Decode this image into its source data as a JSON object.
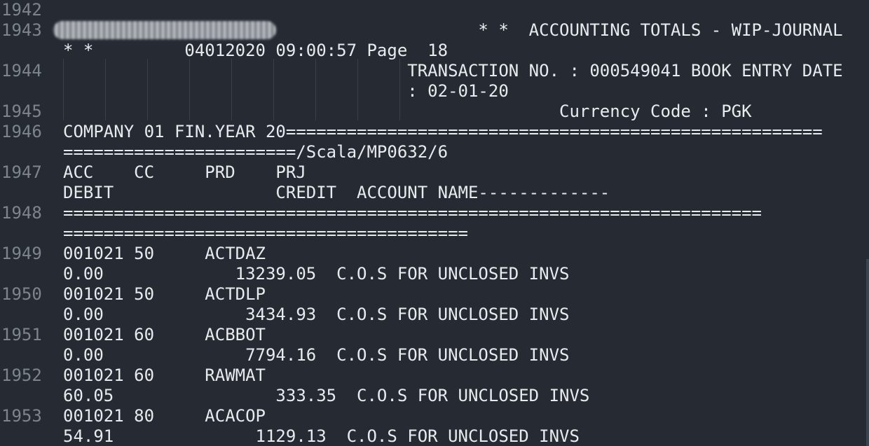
{
  "gutter": [
    "1942",
    "1943",
    "1944",
    "1945",
    "1946",
    "1947",
    "1948",
    "1949",
    "1950",
    "1951",
    "1952",
    "1953"
  ],
  "lines": [
    "",
    "                                         * *  ACCOUNTING TOTALS - WIP-JOURNAL",
    "* *         04012020 09:00:57 Page  18",
    "                                  TRANSACTION NO. : 000549041 BOOK ENTRY DATE",
    "                                  : 02-01-20",
    "                                                 Currency Code : PGK",
    "COMPANY 01 FIN.YEAR 20=====================================================",
    "=======================/Scala/MP0632/6",
    "ACC    CC     PRD    PRJ",
    "DEBIT                CREDIT  ACCOUNT NAME-------------",
    "=====================================================================",
    "========================================",
    "001021 50     ACTDAZ",
    "0.00             13239.05  C.O.S FOR UNCLOSED INVS",
    "001021 50     ACTDLP",
    "0.00              3434.93  C.O.S FOR UNCLOSED INVS",
    "001021 60     ACBBOT",
    "0.00              7794.16  C.O.S FOR UNCLOSED INVS",
    "001021 60     RAWMAT",
    "60.05                333.35  C.O.S FOR UNCLOSED INVS",
    "001021 80     ACACOP",
    "54.91              1129.13  C.O.S FOR UNCLOSED INVS"
  ]
}
